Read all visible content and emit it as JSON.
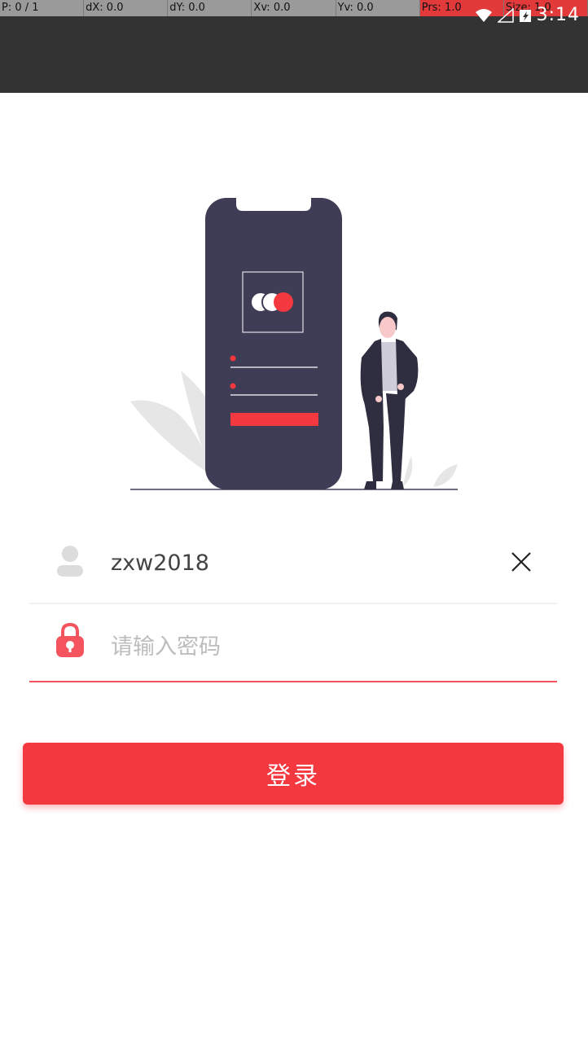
{
  "debug_overlay": {
    "p": "P: 0 / 1",
    "dx": "dX: 0.0",
    "dy": "dY: 0.0",
    "xv": "Xv: 0.0",
    "yv": "Yv: 0.0",
    "prs": "Prs: 1.0",
    "size": "Size: 1.0"
  },
  "status_bar": {
    "time": "3:14",
    "icons": [
      "wifi-icon",
      "signal-icon",
      "battery-icon"
    ]
  },
  "login": {
    "username_value": "zxw2018",
    "password_placeholder": "请输入密码",
    "login_label": "登录"
  },
  "colors": {
    "accent": "#f3383f",
    "phone_body": "#3f3d56",
    "statusbar": "#333333"
  }
}
